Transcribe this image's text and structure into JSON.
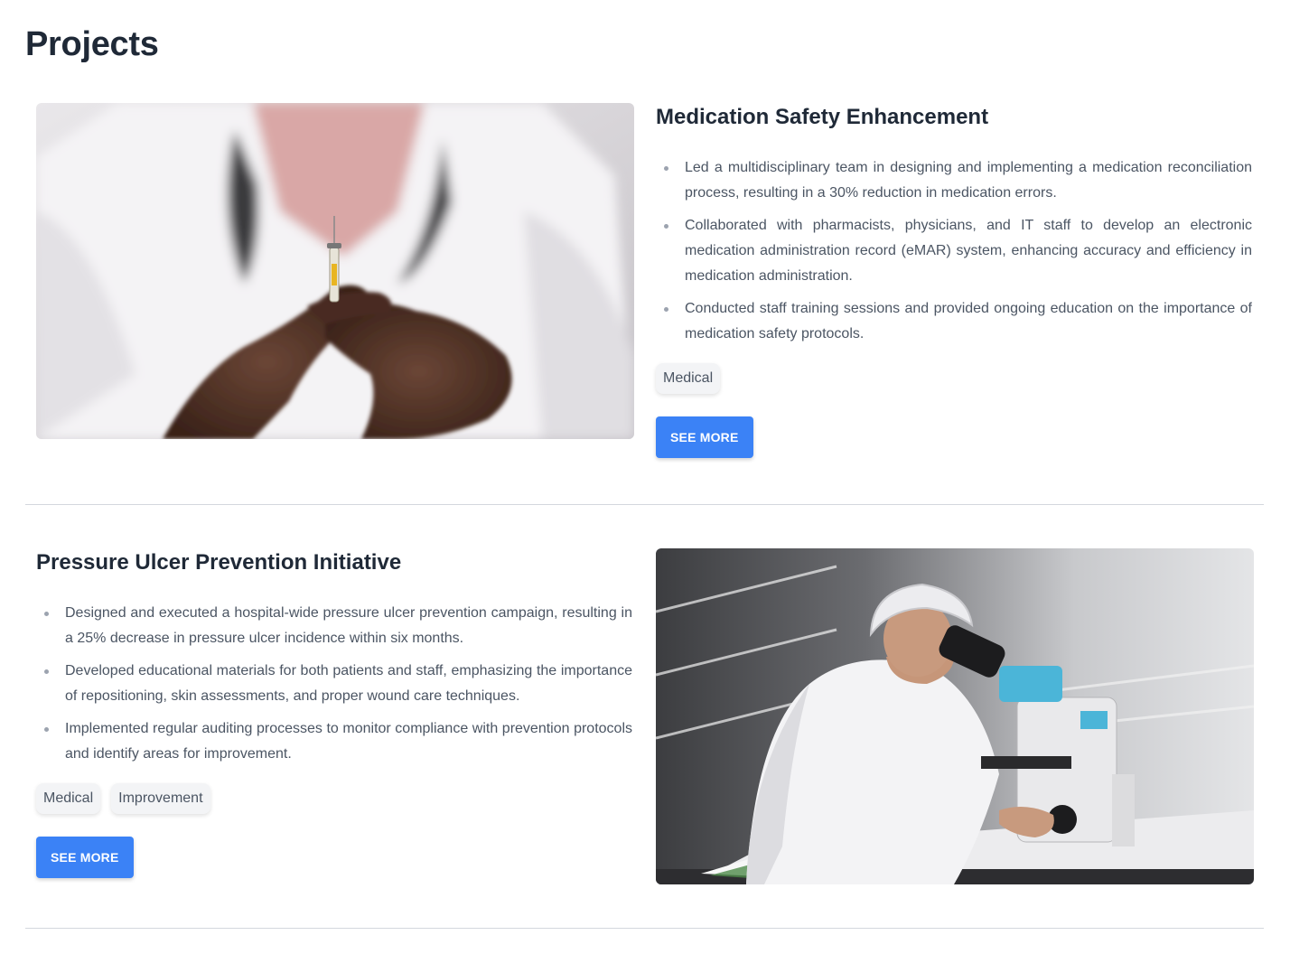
{
  "page": {
    "title": "Projects"
  },
  "projects": [
    {
      "title": "Medication Safety Enhancement",
      "image_alt": "Healthcare worker holding a syringe",
      "bullets": [
        "Led a multidisciplinary team in designing and implementing a medication reconciliation process, resulting in a 30% reduction in medication errors.",
        "Collaborated with pharmacists, physicians, and IT staff to develop an electronic medication administration record (eMAR) system, enhancing accuracy and efficiency in medication administration.",
        "Conducted staff training sessions and provided ongoing education on the importance of medication safety protocols."
      ],
      "tags": [
        "Medical"
      ],
      "button_label": "SEE MORE"
    },
    {
      "title": "Pressure Ulcer Prevention Initiative",
      "image_alt": "Lab technician looking through a microscope",
      "bullets": [
        "Designed and executed a hospital-wide pressure ulcer prevention campaign, resulting in a 25% decrease in pressure ulcer incidence within six months.",
        "Developed educational materials for both patients and staff, emphasizing the importance of repositioning, skin assessments, and proper wound care techniques.",
        "Implemented regular auditing processes to monitor compliance with prevention protocols and identify areas for improvement."
      ],
      "tags": [
        "Medical",
        "Improvement"
      ],
      "button_label": "SEE MORE"
    }
  ],
  "colors": {
    "accent": "#3b82f6",
    "heading": "#1f2937",
    "body_text": "#4b5563",
    "tag_bg": "#f3f4f6",
    "divider": "#d4d7de"
  }
}
